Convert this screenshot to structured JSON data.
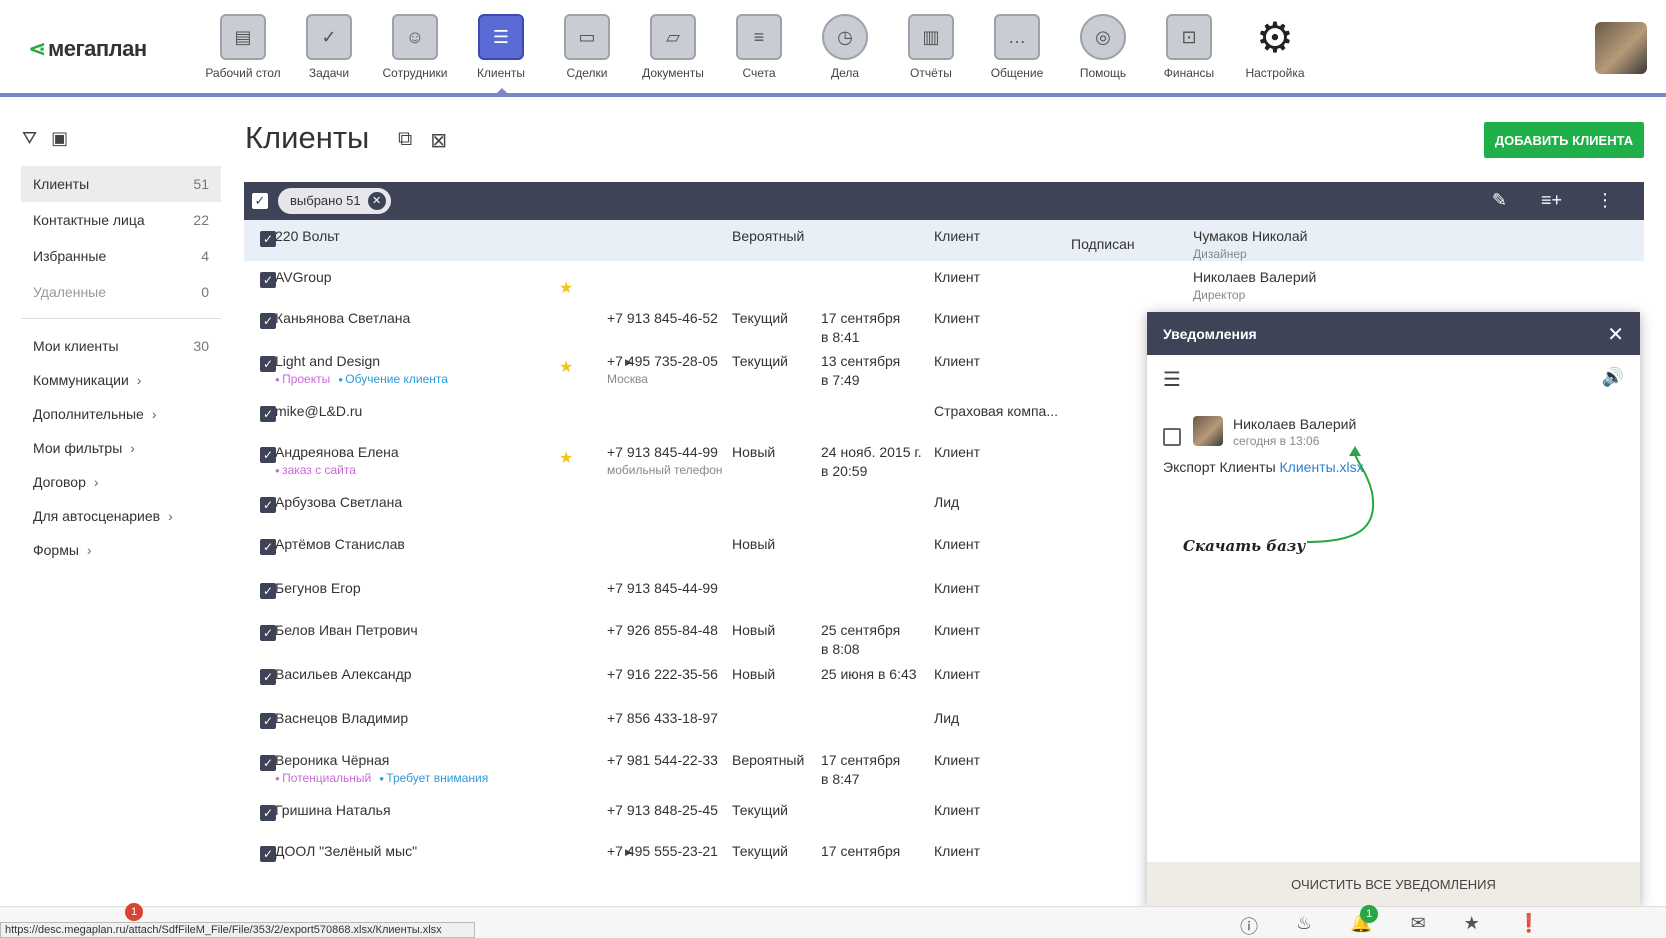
{
  "brand": {
    "logo": "мегаплан"
  },
  "nav": [
    {
      "label": "Рабочий стол",
      "icon": "desktop-icon",
      "glyph": "▤"
    },
    {
      "label": "Задачи",
      "icon": "tasks-icon",
      "glyph": "✓"
    },
    {
      "label": "Сотрудники",
      "icon": "employees-icon",
      "glyph": "☺"
    },
    {
      "label": "Клиенты",
      "icon": "clients-icon",
      "glyph": "☰"
    },
    {
      "label": "Сделки",
      "icon": "deals-icon",
      "glyph": "▭"
    },
    {
      "label": "Документы",
      "icon": "documents-icon",
      "glyph": "▱"
    },
    {
      "label": "Счета",
      "icon": "invoices-icon",
      "glyph": "≡"
    },
    {
      "label": "Дела",
      "icon": "clock-icon",
      "glyph": "◷"
    },
    {
      "label": "Отчёты",
      "icon": "reports-icon",
      "glyph": "▥"
    },
    {
      "label": "Общение",
      "icon": "chat-icon",
      "glyph": "…"
    },
    {
      "label": "Помощь",
      "icon": "help-icon",
      "glyph": "◎"
    },
    {
      "label": "Финансы",
      "icon": "safe-icon",
      "glyph": "⊡"
    },
    {
      "label": "Настройка",
      "icon": "gear-icon",
      "glyph": "⚙"
    }
  ],
  "sidebar": {
    "items": [
      {
        "label": "Клиенты",
        "count": "51"
      },
      {
        "label": "Контактные лица",
        "count": "22"
      },
      {
        "label": "Избранные",
        "count": "4"
      },
      {
        "label": "Удаленные",
        "count": "0"
      }
    ],
    "filters": [
      {
        "label": "Мои клиенты",
        "count": "30"
      },
      {
        "label": "Коммуникации"
      },
      {
        "label": "Дополнительные"
      },
      {
        "label": "Мои фильтры"
      },
      {
        "label": "Договор"
      },
      {
        "label": "Для автосценариев"
      },
      {
        "label": "Формы"
      }
    ]
  },
  "page": {
    "title": "Клиенты",
    "add_button": "ДОБАВИТЬ КЛИЕНТА"
  },
  "selection": {
    "chip": "выбрано 51"
  },
  "rows": [
    {
      "name": "220 Вольт",
      "status": "Вероятный",
      "type": "Клиент",
      "contract": "Подписан",
      "manager": "Чумаков Николай",
      "role": "Дизайнер"
    },
    {
      "name": "AVGroup",
      "star": true,
      "type": "Клиент",
      "manager": "Николаев Валерий",
      "role": "Директор"
    },
    {
      "name": "Каньянова Светлана",
      "phone": "+7 913 845-46-52",
      "status": "Текущий",
      "date": "17 сентября",
      "time": "в 8:41",
      "type": "Клиент"
    },
    {
      "name": "Light and Design",
      "tags": [
        {
          "t": "Проекты",
          "c": "pink"
        },
        {
          "t": "Обучение клиента",
          "c": "blue"
        }
      ],
      "star": true,
      "tri": true,
      "phone": "+7 495 735-28-05",
      "phone_sub": "Москва",
      "status": "Текущий",
      "date": "13 сентября",
      "time": "в 7:49",
      "type": "Клиент"
    },
    {
      "name": "mike@L&D.ru",
      "type": "Страховая компа..."
    },
    {
      "name": "Андреянова Елена",
      "tags": [
        {
          "t": "заказ с сайта",
          "c": "pink"
        }
      ],
      "star": true,
      "phone": "+7 913 845-44-99",
      "phone_sub": "мобильный телефон",
      "status": "Новый",
      "date": "24 нояб. 2015 г.",
      "time": "в 20:59",
      "type": "Клиент"
    },
    {
      "name": "Арбузова Светлана",
      "type": "Лид"
    },
    {
      "name": "Артёмов Станислав",
      "status": "Новый",
      "type": "Клиент"
    },
    {
      "name": "Бегунов Егор",
      "phone": "+7 913 845-44-99",
      "type": "Клиент"
    },
    {
      "name": "Белов Иван Петрович",
      "phone": "+7 926 855-84-48",
      "status": "Новый",
      "date": "25 сентября",
      "time": "в 8:08",
      "type": "Клиент"
    },
    {
      "name": "Васильев Александр",
      "phone": "+7 916 222-35-56",
      "status": "Новый",
      "date": "25 июня в 6:43",
      "type": "Клиент"
    },
    {
      "name": "Васнецов Владимир",
      "phone": "+7 856 433-18-97",
      "type": "Лид"
    },
    {
      "name": "Вероника Чёрная",
      "tags": [
        {
          "t": "Потенциальный",
          "c": "pink"
        },
        {
          "t": "Требует внимания",
          "c": "blue"
        }
      ],
      "phone": "+7 981 544-22-33",
      "status": "Вероятный",
      "date": "17 сентября",
      "time": "в 8:47",
      "type": "Клиент"
    },
    {
      "name": "Гришина Наталья",
      "phone": "+7 913 848-25-45",
      "status": "Текущий",
      "type": "Клиент"
    },
    {
      "name": "ДООЛ \"Зелёный мыс\"",
      "tri": true,
      "phone": "+7 495 555-23-21",
      "status": "Текущий",
      "date": "17 сентября",
      "type": "Клиент"
    }
  ],
  "notifications": {
    "title": "Уведомления",
    "item": {
      "author": "Николаев Валерий",
      "time": "сегодня в 13:06",
      "text": "Экспорт Клиенты",
      "link": "Клиенты.xlsx"
    },
    "annotation": "Скачать базу",
    "clear_button": "ОЧИСТИТЬ ВСЕ УВЕДОМЛЕНИЯ"
  },
  "statusbar": {
    "url": "https://desc.megaplan.ru/attach/SdfFileM_File/File/353/2/export570868.xlsx/Клиенты.xlsx",
    "left_badge": "1",
    "bell_badge": "1"
  },
  "colors": {
    "accent": "#20b04a",
    "nav_underline": "#7b86c7",
    "dark": "#3f4358",
    "link": "#2d7fd1"
  }
}
